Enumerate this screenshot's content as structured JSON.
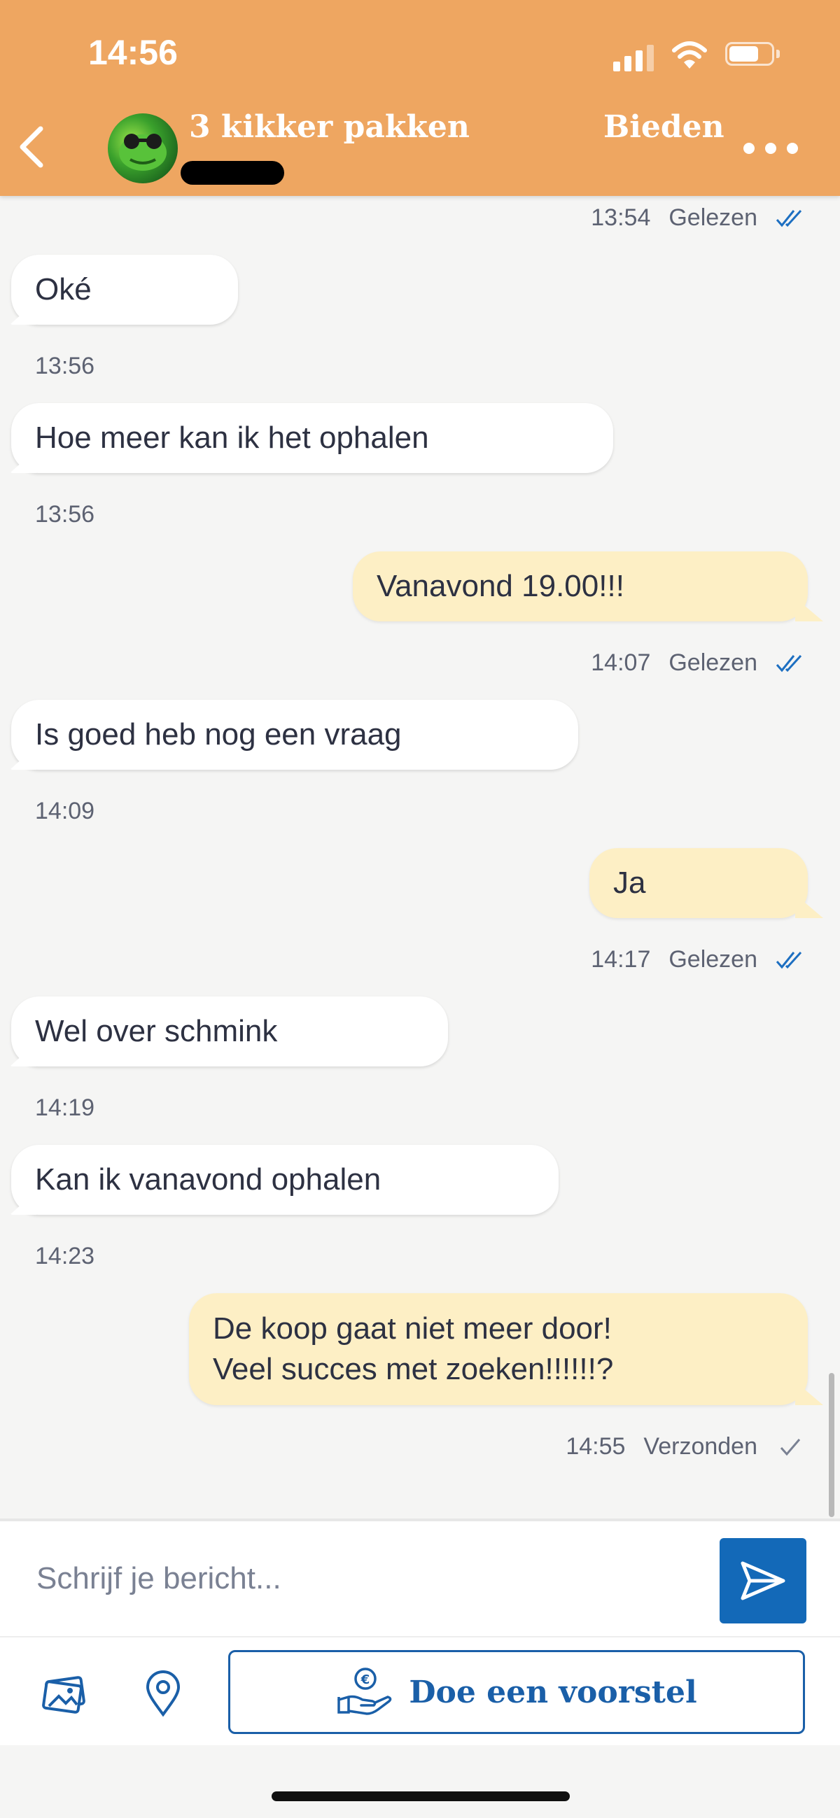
{
  "status_bar": {
    "time": "14:56",
    "battery_percent": 70
  },
  "header": {
    "title": "3 kikker pakken",
    "bid_label": "Bieden",
    "back_icon": "chevron-left-icon",
    "more_icon": "more-horizontal-icon"
  },
  "messages": [
    {
      "direction": "out",
      "text": "",
      "time": "13:54",
      "status": "Gelezen",
      "status_icon": "double-check-icon"
    },
    {
      "direction": "in",
      "text": "Oké",
      "time": "13:56"
    },
    {
      "direction": "in",
      "text": "Hoe meer kan ik het ophalen",
      "time": "13:56"
    },
    {
      "direction": "out",
      "text": "Vanavond 19.00!!!",
      "time": "14:07",
      "status": "Gelezen",
      "status_icon": "double-check-icon"
    },
    {
      "direction": "in",
      "text": "Is goed heb nog een vraag",
      "time": "14:09"
    },
    {
      "direction": "out",
      "text": "Ja",
      "time": "14:17",
      "status": "Gelezen",
      "status_icon": "double-check-icon"
    },
    {
      "direction": "in",
      "text": "Wel over schmink",
      "time": "14:19"
    },
    {
      "direction": "in",
      "text": "Kan ik vanavond ophalen",
      "time": "14:23"
    },
    {
      "direction": "out",
      "text": "De koop gaat niet meer door!\nVeel succes met zoeken!!!!!!?",
      "time": "14:55",
      "status": "Verzonden",
      "status_icon": "single-check-icon"
    }
  ],
  "composer": {
    "placeholder": "Schrijf je bericht...",
    "value": "",
    "send_icon": "send-icon"
  },
  "toolbar": {
    "photo_icon": "photos-icon",
    "location_icon": "location-pin-icon",
    "offer_label": "Doe een voorstel",
    "offer_icon": "hand-euro-icon"
  },
  "colors": {
    "header": "#eea661",
    "incoming_bubble": "#ffffff",
    "outgoing_bubble": "#fdefc5",
    "accent_blue": "#1369b8",
    "read_check": "#1d6fc1"
  }
}
